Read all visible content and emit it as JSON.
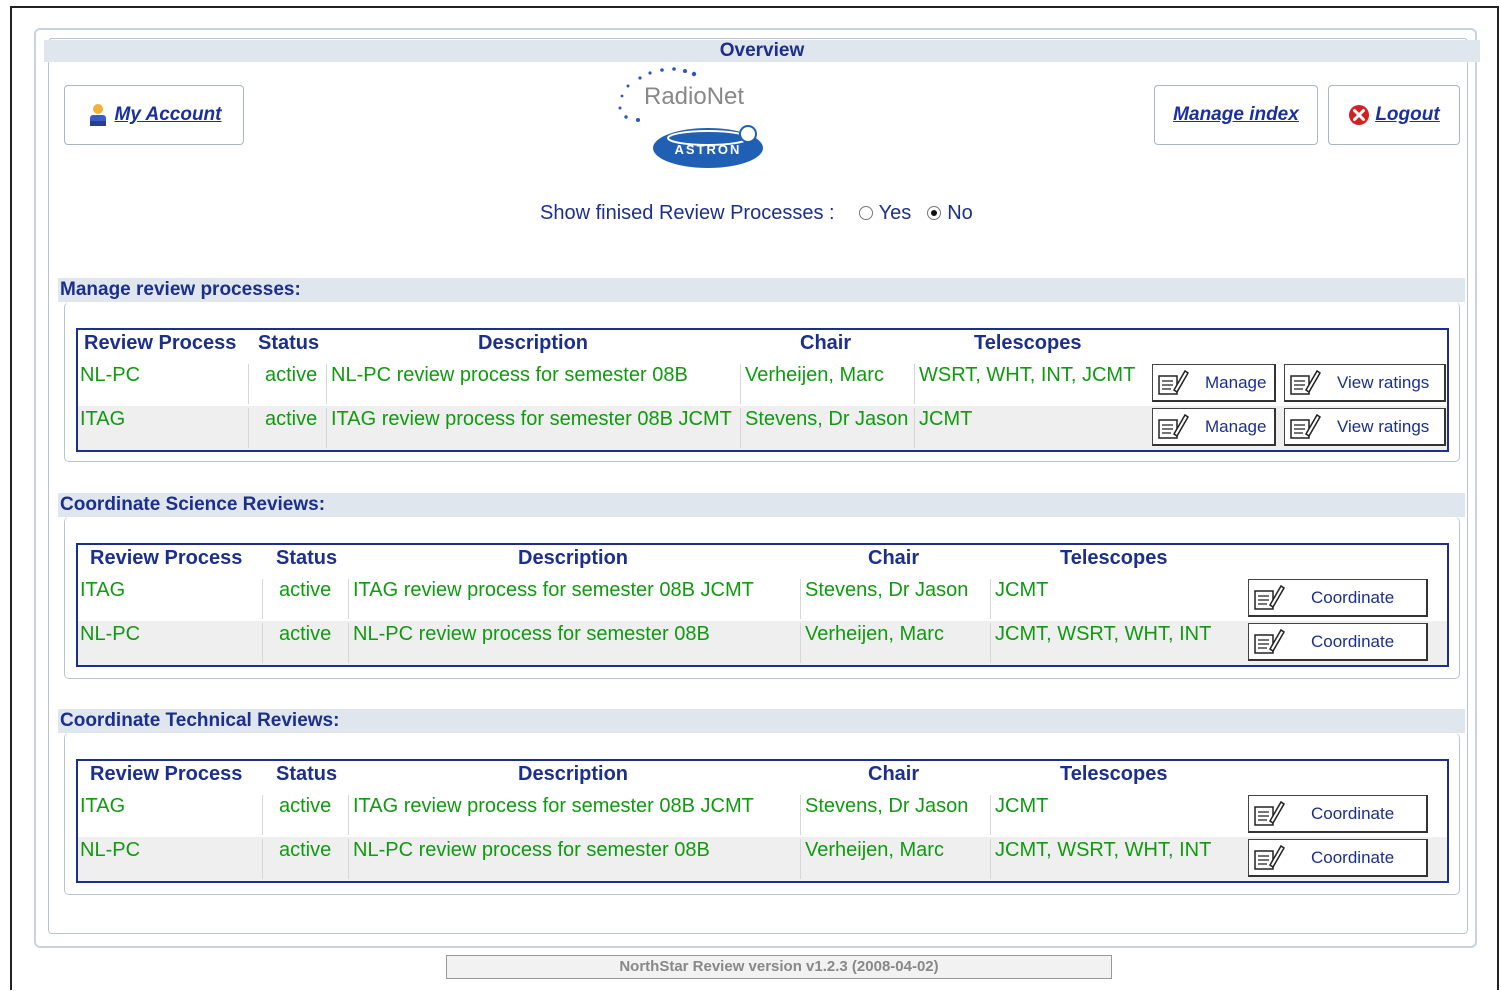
{
  "header": {
    "title": "Overview",
    "my_account": "My Account",
    "manage_index": "Manage index",
    "logout": "Logout",
    "logo_radionet": "RadioNet",
    "logo_astron": "ASTRON"
  },
  "filter": {
    "label": "Show finised Review Processes :",
    "yes": "Yes",
    "no": "No",
    "selected": "No"
  },
  "manage": {
    "title": "Manage review processes:",
    "headers": [
      "Review Process",
      "Status",
      "Description",
      "Chair",
      "Telescopes"
    ],
    "manage_label": "Manage",
    "view_label": "View ratings",
    "rows": [
      {
        "process": "NL-PC",
        "status": "active",
        "description": "NL-PC review process for semester 08B",
        "chair": "Verheijen, Marc",
        "telescopes": "WSRT, WHT, INT, JCMT"
      },
      {
        "process": "ITAG",
        "status": "active",
        "description": "ITAG review process for semester 08B JCMT",
        "chair": "Stevens, Dr Jason",
        "telescopes": "JCMT"
      }
    ]
  },
  "science": {
    "title": "Coordinate Science Reviews:",
    "headers": [
      "Review Process",
      "Status",
      "Description",
      "Chair",
      "Telescopes"
    ],
    "coordinate_label": "Coordinate",
    "rows": [
      {
        "process": "ITAG",
        "status": "active",
        "description": "ITAG review process for semester 08B JCMT",
        "chair": "Stevens, Dr Jason",
        "telescopes": "JCMT"
      },
      {
        "process": "NL-PC",
        "status": "active",
        "description": "NL-PC review process for semester 08B",
        "chair": "Verheijen, Marc",
        "telescopes": "JCMT, WSRT, WHT, INT"
      }
    ]
  },
  "technical": {
    "title": "Coordinate Technical Reviews:",
    "headers": [
      "Review Process",
      "Status",
      "Description",
      "Chair",
      "Telescopes"
    ],
    "coordinate_label": "Coordinate",
    "rows": [
      {
        "process": "ITAG",
        "status": "active",
        "description": "ITAG review process for semester 08B JCMT",
        "chair": "Stevens, Dr Jason",
        "telescopes": "JCMT"
      },
      {
        "process": "NL-PC",
        "status": "active",
        "description": "NL-PC review process for semester 08B",
        "chair": "Verheijen, Marc",
        "telescopes": "JCMT, WSRT, WHT, INT"
      }
    ]
  },
  "footer": {
    "version": "NorthStar Review version v1.2.3 (2008-04-02)"
  },
  "colors": {
    "heading": "#1c2f8c",
    "cell_text": "#109a10",
    "bar_bg": "#dfe6ee",
    "alt_row": "#efefef"
  }
}
